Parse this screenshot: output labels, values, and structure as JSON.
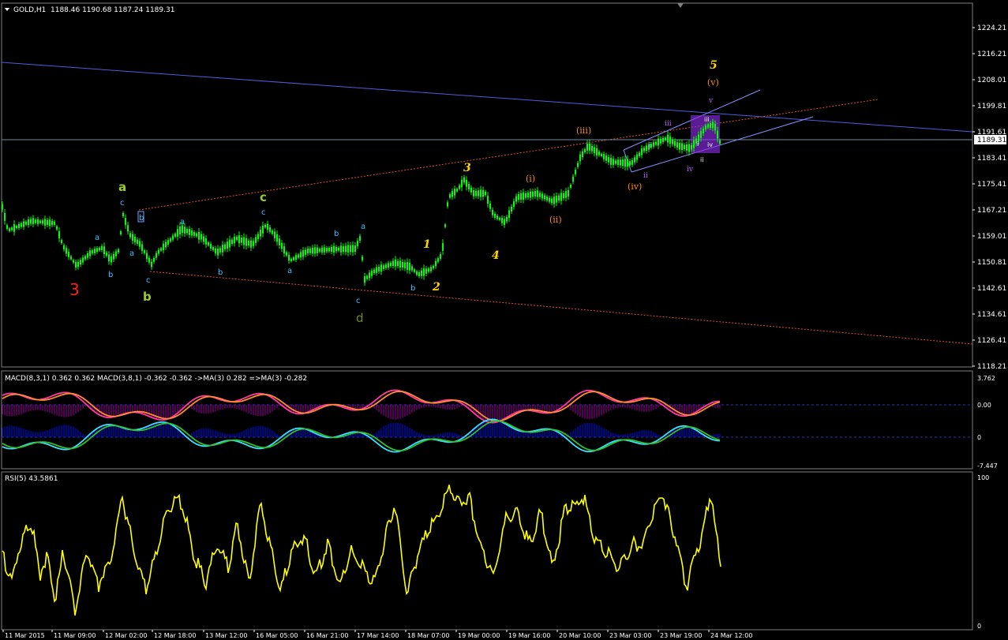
{
  "header": {
    "symbol": "GOLD,H1",
    "ohlc": "1188.46 1190.68 1187.24 1189.31"
  },
  "price_axis": {
    "ticks": [
      "1224.21",
      "1216.21",
      "1208.01",
      "1199.81",
      "1191.61",
      "1183.41",
      "1175.41",
      "1167.21",
      "1159.01",
      "1150.81",
      "1142.61",
      "1134.61",
      "1126.41",
      "1118.21"
    ],
    "current_price": "1189.31"
  },
  "macd_panel": {
    "label": "MACD(8,3,1) 0.362 0.362  MACD(3,8,1) -0.362 -0.362  ->MA(3) 0.282  =>MA(3) -0.282",
    "ticks": [
      "3.762",
      "0.00",
      "0",
      "-7.447"
    ]
  },
  "rsi_panel": {
    "label": "RSI(5) 43.5861",
    "ticks": [
      "100",
      "0"
    ]
  },
  "time_axis": {
    "labels": [
      "11 Mar 2015",
      "11 Mar 09:00",
      "12 Mar 02:00",
      "12 Mar 18:00",
      "13 Mar 12:00",
      "16 Mar 05:00",
      "16 Mar 21:00",
      "17 Mar 14:00",
      "18 Mar 07:00",
      "19 Mar 00:00",
      "19 Mar 16:00",
      "20 Mar 10:00",
      "23 Mar 03:00",
      "23 Mar 19:00",
      "24 Mar 12:00"
    ]
  },
  "wave_labels": [
    {
      "text": "3",
      "color": "#ff2020"
    },
    {
      "text": "a",
      "color": "#9acd32"
    },
    {
      "text": "b",
      "color": "#9acd32"
    },
    {
      "text": "c",
      "color": "#9acd32"
    },
    {
      "text": "d",
      "color": "#6b8e23"
    },
    {
      "text": "1",
      "color": "#ffd700"
    },
    {
      "text": "2",
      "color": "#ffd700"
    },
    {
      "text": "3",
      "color": "#ffd700"
    },
    {
      "text": "4",
      "color": "#ffd700"
    },
    {
      "text": "5",
      "color": "#ffd700"
    },
    {
      "text": "(i)",
      "color": "#ff8c00"
    },
    {
      "text": "(ii)",
      "color": "#ff8c00"
    },
    {
      "text": "(iii)",
      "color": "#ff8c00"
    },
    {
      "text": "(iv)",
      "color": "#ff8c00"
    },
    {
      "text": "(v)",
      "color": "#ff8c00"
    },
    {
      "text": "i",
      "color": "#c060ff"
    },
    {
      "text": "ii",
      "color": "#c060ff"
    },
    {
      "text": "iii",
      "color": "#c060ff"
    },
    {
      "text": "iv",
      "color": "#c060ff"
    },
    {
      "text": "v",
      "color": "#c060ff"
    }
  ],
  "colors": {
    "background": "#000000",
    "candles": "#00ff00",
    "macd_main": "#ff3c9c",
    "macd_ma": "#ff8c30",
    "macd_signal": "#3ce0ff",
    "macd_signal_ma": "#30c030",
    "macd_hist_pos": "#c000c0",
    "macd_hist_neg": "#0000ff",
    "rsi": "#ffff00",
    "resistance_line": "#4a5ee0",
    "trend_dotted": "#e0502a",
    "highlight_box": "#8a2be2"
  }
}
